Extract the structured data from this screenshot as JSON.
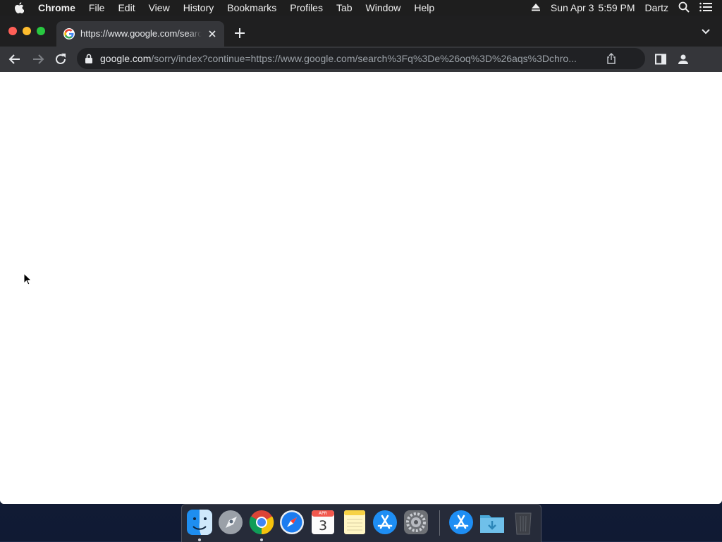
{
  "menubar": {
    "app": "Chrome",
    "items": [
      "File",
      "Edit",
      "View",
      "History",
      "Bookmarks",
      "Profiles",
      "Tab",
      "Window",
      "Help"
    ],
    "date": "Sun Apr 3",
    "time": "5:59 PM",
    "user": "Dartz"
  },
  "browser": {
    "tab_title": "https://www.google.com/search?q=&oq=",
    "url_host": "google.com",
    "url_path": "/sorry/index?continue=https://www.google.com/search%3Fq%3De%26oq%3D%26aqs%3Dchro..."
  },
  "dock": {
    "apps": [
      "Finder",
      "Launchpad",
      "Google Chrome",
      "Safari",
      "Calendar",
      "Notes",
      "App Store",
      "System Preferences",
      "App Store",
      "Downloads",
      "Trash"
    ],
    "calendar_month": "APR",
    "calendar_day": "3"
  },
  "icons": {
    "apple": "apple-icon",
    "eject": "eject-icon",
    "spotlight": "search-icon",
    "control_center": "list-icon",
    "back": "arrow-left-icon",
    "forward": "arrow-right-icon",
    "reload": "reload-icon",
    "lock": "lock-icon",
    "share": "share-icon",
    "side_panel": "side-panel-icon",
    "profile": "profile-icon"
  },
  "colors": {
    "menubar_bg": "#1e1e1e",
    "tabstrip_bg": "#1f1f20",
    "toolbar_bg": "#35363a",
    "omnibox_bg": "#202124",
    "close": "#ff5f57",
    "minimize": "#febc2e",
    "maximize": "#28c840"
  }
}
